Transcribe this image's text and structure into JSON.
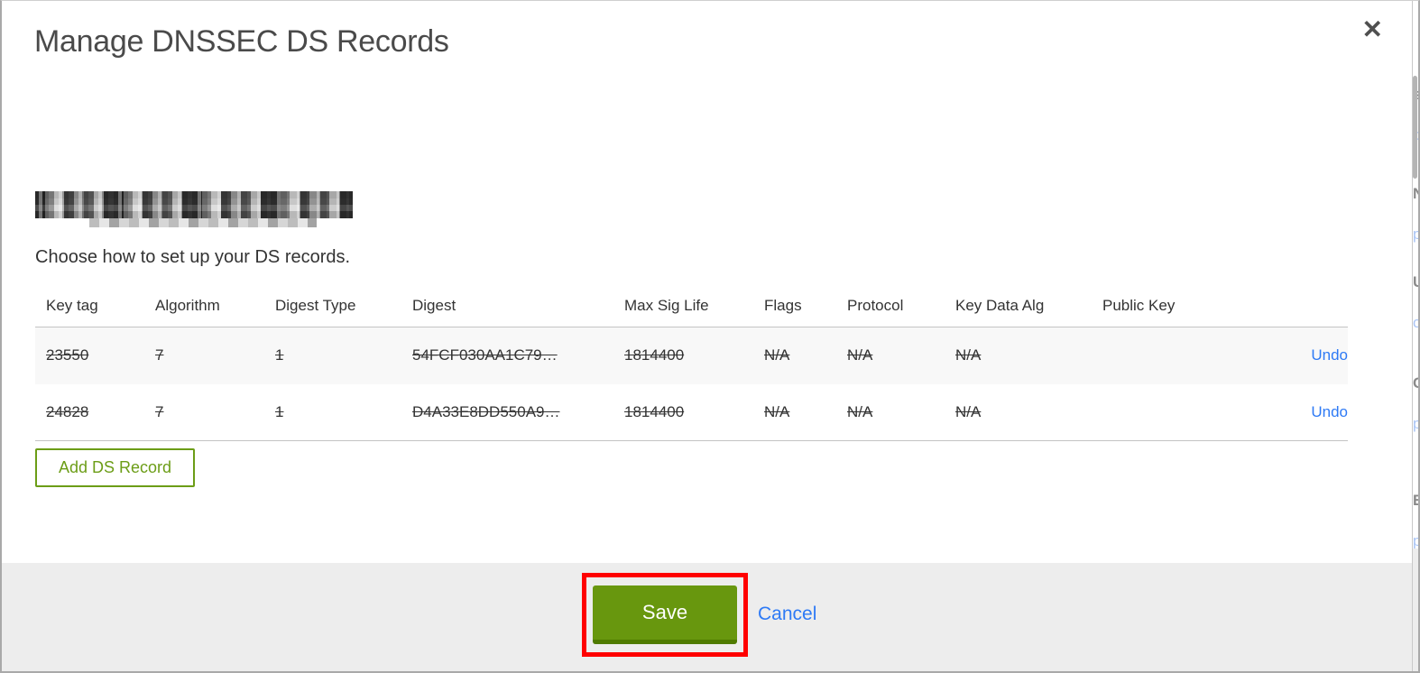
{
  "dialog": {
    "title": "Manage DNSSEC DS Records",
    "instruction": "Choose how to set up your DS records.",
    "close_glyph": "✕",
    "domain": {
      "redacted": true
    }
  },
  "table": {
    "headers": [
      "Key tag",
      "Algorithm",
      "Digest Type",
      "Digest",
      "Max Sig Life",
      "Flags",
      "Protocol",
      "Key Data Alg",
      "Public Key"
    ],
    "rows": [
      {
        "key_tag": "23550",
        "algorithm": "7",
        "digest_type": "1",
        "digest": "54FCF030AA1C79…",
        "max_sig_life": "1814400",
        "flags": "N/A",
        "protocol": "N/A",
        "key_data_alg": "N/A",
        "public_key": "",
        "action": "Undo",
        "struck_out": true
      },
      {
        "key_tag": "24828",
        "algorithm": "7",
        "digest_type": "1",
        "digest": "D4A33E8DD550A9…",
        "max_sig_life": "1814400",
        "flags": "N/A",
        "protocol": "N/A",
        "key_data_alg": "N/A",
        "public_key": "",
        "action": "Undo",
        "struck_out": true
      }
    ]
  },
  "buttons": {
    "add_ds_record": "Add DS Record",
    "save": "Save",
    "cancel": "Cancel"
  },
  "colors": {
    "accent_green": "#68970e",
    "accent_green_dark": "#4f7b00",
    "link_blue": "#2e7af5",
    "annotation_red": "#ff0000",
    "footer_gray": "#ededed",
    "row_stripe_gray": "#f8f8f8"
  },
  "edge": {
    "fragments": [
      "s",
      "d",
      "N",
      "p",
      "U",
      "o",
      "C",
      "p",
      "E",
      "p"
    ]
  }
}
